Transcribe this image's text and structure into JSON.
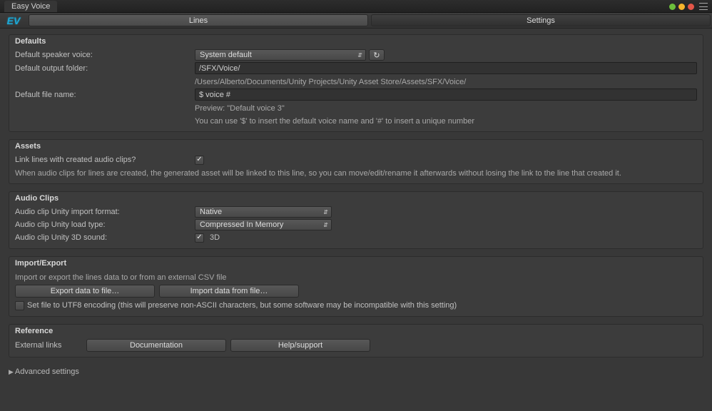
{
  "window": {
    "title": "Easy Voice",
    "logo": "EV"
  },
  "tabs": {
    "lines": "Lines",
    "settings": "Settings",
    "active": "settings"
  },
  "defaults": {
    "header": "Defaults",
    "speaker_label": "Default speaker voice:",
    "speaker_value": "System default",
    "output_label": "Default output folder:",
    "output_value": "/SFX/Voice/",
    "output_resolved": "/Users/Alberto/Documents/Unity Projects/Unity Asset Store/Assets/SFX/Voice/",
    "filename_label": "Default file name:",
    "filename_value": "$ voice #",
    "filename_preview": "Preview: \"Default voice 3\"",
    "filename_hint": "You can use '$' to insert the default voice name and '#' to insert a unique number"
  },
  "assets": {
    "header": "Assets",
    "link_label": "Link lines with created audio clips?",
    "link_checked": true,
    "help": "When audio clips for lines are created, the generated asset will be linked to this line, so you can move/edit/rename it afterwards without losing the link to the line that created it."
  },
  "audioclips": {
    "header": "Audio Clips",
    "import_label": "Audio clip Unity import format:",
    "import_value": "Native",
    "loadtype_label": "Audio clip Unity load type:",
    "loadtype_value": "Compressed In Memory",
    "sound3d_label": "Audio clip Unity 3D sound:",
    "sound3d_checked": true,
    "sound3d_cblabel": "3D"
  },
  "io": {
    "header": "Import/Export",
    "help": "Import or export the lines data to or from an external CSV file",
    "export_btn": "Export data to file…",
    "import_btn": "Import data from file…",
    "utf8_checked": false,
    "utf8_label": "Set file to UTF8 encoding (this will preserve non-ASCII characters, but some software may be incompatible with this setting)"
  },
  "reference": {
    "header": "Reference",
    "links_label": "External links",
    "docs_btn": "Documentation",
    "help_btn": "Help/support"
  },
  "advanced": {
    "label": "Advanced settings"
  }
}
